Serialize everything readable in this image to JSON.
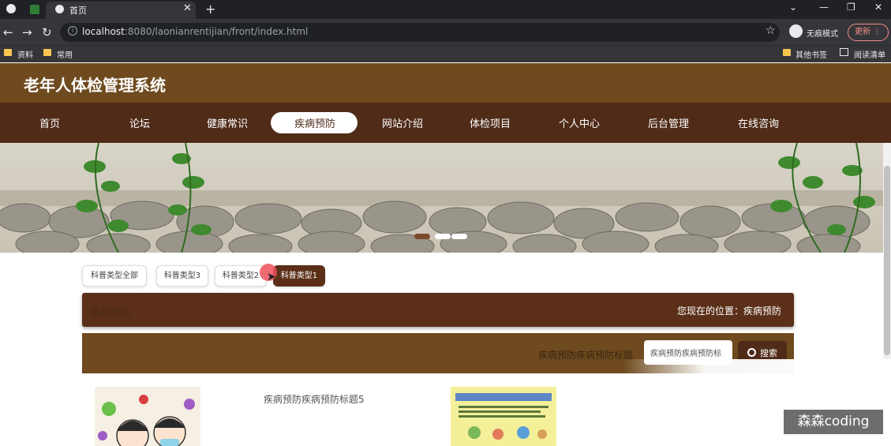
{
  "browser": {
    "tab_title": "首页",
    "tab_close": "✕",
    "new_tab": "+",
    "url_host": "localhost",
    "url_rest": ":8080/laonianrentijian/front/index.html",
    "incognito_label": "无痕模式",
    "update_label": "更新 ⋮",
    "bookmarks": [
      "资料",
      "常用"
    ],
    "bookmarks_right": [
      "其他书签",
      "阅读清单"
    ]
  },
  "site": {
    "title": "老年人体检管理系统",
    "nav": [
      "首页",
      "论坛",
      "健康常识",
      "疾病预防",
      "网站介绍",
      "体检项目",
      "个人中心",
      "后台管理",
      "在线咨询"
    ],
    "active_nav": "疾病预防"
  },
  "categories": [
    "科普类型全部",
    "科普类型3",
    "科普类型2",
    "科普类型1"
  ],
  "active_category": "科普类型1",
  "section": {
    "title": "疾病预防",
    "location": "您现在的位置：疾病预防"
  },
  "search": {
    "label": "疾病预防疾病预防标题",
    "input_value": "疾病预防疾病预防标",
    "button_label": "搜索"
  },
  "cards": [
    {
      "title": "疾病预防疾病预防标题5"
    }
  ],
  "watermark": "森森coding",
  "colors": {
    "header_brown": "#6e4a1e",
    "nav_dark_brown": "#4f2b18",
    "accent": "#5b2f18"
  }
}
